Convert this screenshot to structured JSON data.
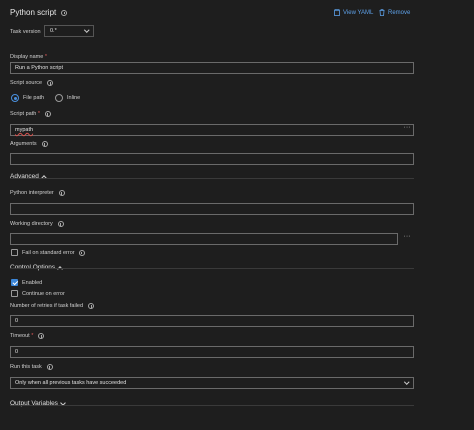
{
  "header": {
    "title": "Python script",
    "view_yaml_label": "View YAML",
    "remove_label": "Remove"
  },
  "task_version": {
    "label": "Task version",
    "value": "0.*"
  },
  "display_name": {
    "label": "Display name",
    "required_mark": "*",
    "value": "Run a Python script"
  },
  "script_source": {
    "label": "Script source",
    "options": [
      "File path",
      "Inline"
    ],
    "selected": "File path"
  },
  "script_path": {
    "label": "Script path",
    "required_mark": "*",
    "value": "mypath",
    "more_label": "···"
  },
  "arguments": {
    "label": "Arguments",
    "value": ""
  },
  "advanced": {
    "section_label": "Advanced",
    "python_interpreter": {
      "label": "Python interpreter",
      "value": ""
    },
    "working_directory": {
      "label": "Working directory",
      "value": "",
      "more_label": "···"
    },
    "fail_on_stderr": {
      "label": "Fail on standard error",
      "checked": false
    }
  },
  "control_options": {
    "section_label": "Control Options",
    "enabled": {
      "label": "Enabled",
      "checked": true
    },
    "continue_on_error": {
      "label": "Continue on error",
      "checked": false
    },
    "retries": {
      "label": "Number of retries if task failed",
      "value": "0"
    },
    "timeout": {
      "label": "Timeout",
      "required_mark": "*",
      "value": "0"
    },
    "run_this_task": {
      "label": "Run this task",
      "value": "Only when all previous tasks have succeeded"
    }
  },
  "output_variables": {
    "section_label": "Output Variables"
  },
  "colors": {
    "background": "#1e1e1e",
    "accent": "#5ea1e8",
    "checkbox": "#3b86d8",
    "required": "#e35a5a"
  }
}
